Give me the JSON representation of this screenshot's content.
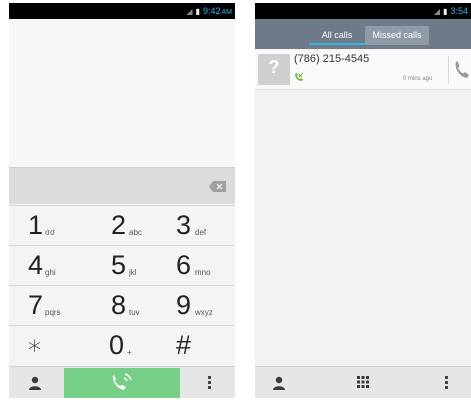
{
  "dialer": {
    "status_time": "9:42",
    "status_ampm": "AM",
    "keys": [
      {
        "num": "1",
        "sub": "σσ"
      },
      {
        "num": "2",
        "sub": "abc"
      },
      {
        "num": "3",
        "sub": "def"
      },
      {
        "num": "4",
        "sub": "ghi"
      },
      {
        "num": "5",
        "sub": "jkl"
      },
      {
        "num": "6",
        "sub": "mno"
      },
      {
        "num": "7",
        "sub": "pqrs"
      },
      {
        "num": "8",
        "sub": "tuv"
      },
      {
        "num": "9",
        "sub": "wxyz"
      },
      {
        "num": "∗",
        "sub": ""
      },
      {
        "num": "0",
        "sub": "+"
      },
      {
        "num": "#",
        "sub": ""
      }
    ],
    "icons": {
      "backspace": "backspace-icon",
      "contacts": "person-icon",
      "call": "phone-call-icon",
      "menu": "overflow-menu-icon"
    },
    "colors": {
      "call_button": "#76cf86",
      "status_accent": "#33b5e5"
    }
  },
  "calllog": {
    "status_time": "3:54",
    "tabs": [
      {
        "label": "All calls"
      },
      {
        "label": "Missed calls"
      }
    ],
    "entries": [
      {
        "number": "(786) 215-4545",
        "time_ago": "0 mins ago",
        "type": "incoming"
      }
    ],
    "avatar_glyph": "?",
    "icons": {
      "contacts": "person-icon",
      "dialpad": "dialpad-icon",
      "menu": "overflow-menu-icon",
      "callback": "phone-icon"
    },
    "colors": {
      "tabbar": "#6e7a88",
      "tab_selected": "#8e9aa6",
      "incoming": "#7ab648"
    }
  }
}
